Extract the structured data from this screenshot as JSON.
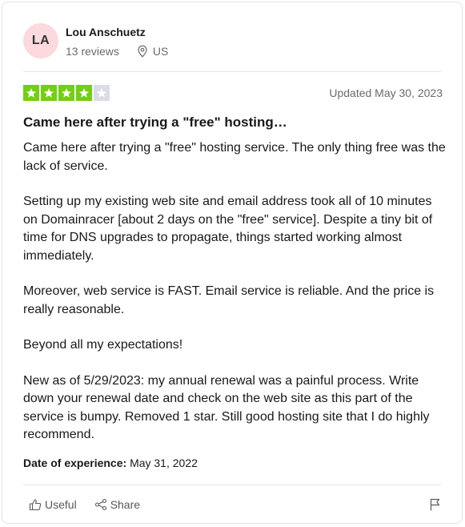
{
  "reviewer": {
    "initials": "LA",
    "name": "Lou Anschuetz",
    "reviews": "13 reviews",
    "country": "US"
  },
  "review": {
    "rating": 4,
    "max_rating": 5,
    "updated": "Updated May 30, 2023",
    "title": "Came here after trying a \"free\" hosting…",
    "paragraphs": [
      "Came here after trying a \"free\" hosting service. The only thing free was the lack of service.",
      "Setting up my existing web site and email address took all of 10 minutes on Domainracer [about 2 days on the \"free\" service]. Despite a tiny bit of time for DNS upgrades to propagate, things started working almost immediately.",
      "Moreover, web service is FAST. Email service is reliable. And the price is really reasonable.",
      "Beyond all my expectations!",
      "New as of 5/29/2023: my annual renewal was a painful process. Write down your renewal date and check on the web site as this part of the service is bumpy. Removed 1 star. Still good hosting site that I do highly recommend."
    ],
    "experience_label": "Date of experience:",
    "experience_date": "May 31, 2022"
  },
  "actions": {
    "useful_label": "Useful",
    "share_label": "Share"
  },
  "icons": {
    "location": "map-pin-icon",
    "useful": "thumbs-up-icon",
    "share": "share-icon",
    "report": "flag-icon",
    "star": "star-icon"
  },
  "colors": {
    "star_on": "#73cf11",
    "star_off": "#dcdce6",
    "avatar_bg": "#fbd9dd"
  }
}
